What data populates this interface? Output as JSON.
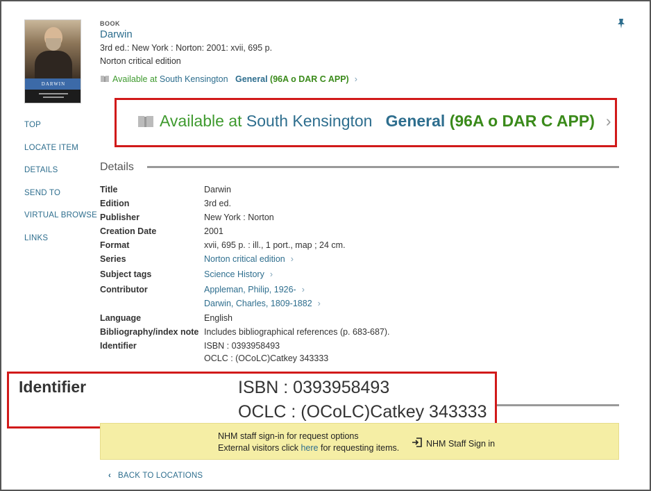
{
  "record": {
    "type_label": "BOOK",
    "title": "Darwin",
    "edition_line": "3rd ed.: New York : Norton: 2001: xvii, 695 p.",
    "series_line": "Norton critical edition",
    "cover": {
      "band_text": "DARWIN"
    }
  },
  "availability": {
    "prefix": "Available at ",
    "location": "South Kensington",
    "collection": "General",
    "callnumber": "(96A o DAR C APP)",
    "chevron": "›"
  },
  "nav": {
    "items": [
      {
        "label": "TOP"
      },
      {
        "label": "LOCATE ITEM"
      },
      {
        "label": "DETAILS"
      },
      {
        "label": "SEND TO"
      },
      {
        "label": "VIRTUAL BROWSE"
      },
      {
        "label": "LINKS"
      }
    ]
  },
  "details": {
    "heading": "Details",
    "rows": [
      {
        "label": "Title",
        "values": [
          "Darwin"
        ]
      },
      {
        "label": "Edition",
        "values": [
          "3rd ed."
        ]
      },
      {
        "label": "Publisher",
        "values": [
          "New York : Norton"
        ]
      },
      {
        "label": "Creation Date",
        "values": [
          "2001"
        ]
      },
      {
        "label": "Format",
        "values": [
          "xvii, 695 p. : ill., 1 port., map ; 24 cm."
        ]
      },
      {
        "label": "Series",
        "values": [
          "Norton critical edition"
        ],
        "link": true
      },
      {
        "label": "Subject tags",
        "values": [
          "Science History"
        ],
        "link": true
      },
      {
        "label": "Contributor",
        "values": [
          "Appleman, Philip, 1926-",
          "Darwin, Charles, 1809-1882"
        ],
        "link": true
      },
      {
        "label": "Language",
        "values": [
          "English"
        ]
      },
      {
        "label": "Bibliography/index note",
        "values": [
          "Includes bibliographical references (p. 683-687)."
        ]
      },
      {
        "label": "Identifier",
        "values": [
          "ISBN : 0393958493",
          "OCLC : (OCoLC)Catkey 343333"
        ]
      }
    ]
  },
  "identifier_callout": {
    "label": "Identifier",
    "isbn": "ISBN : 0393958493",
    "oclc": "OCLC : (OCoLC)Catkey 343333"
  },
  "staff_notice": {
    "line1": "NHM staff sign-in for request options",
    "line2_before": "External visitors click ",
    "line2_link": "here",
    "line2_after": " for requesting items.",
    "signin_label": "NHM Staff Sign in"
  },
  "back_link": {
    "label": "BACK TO LOCATIONS"
  },
  "colors": {
    "link": "#2e6e8e",
    "available": "#3f9a2f",
    "callout_border": "#d11a1a",
    "notice_bg": "#f5eea5"
  }
}
